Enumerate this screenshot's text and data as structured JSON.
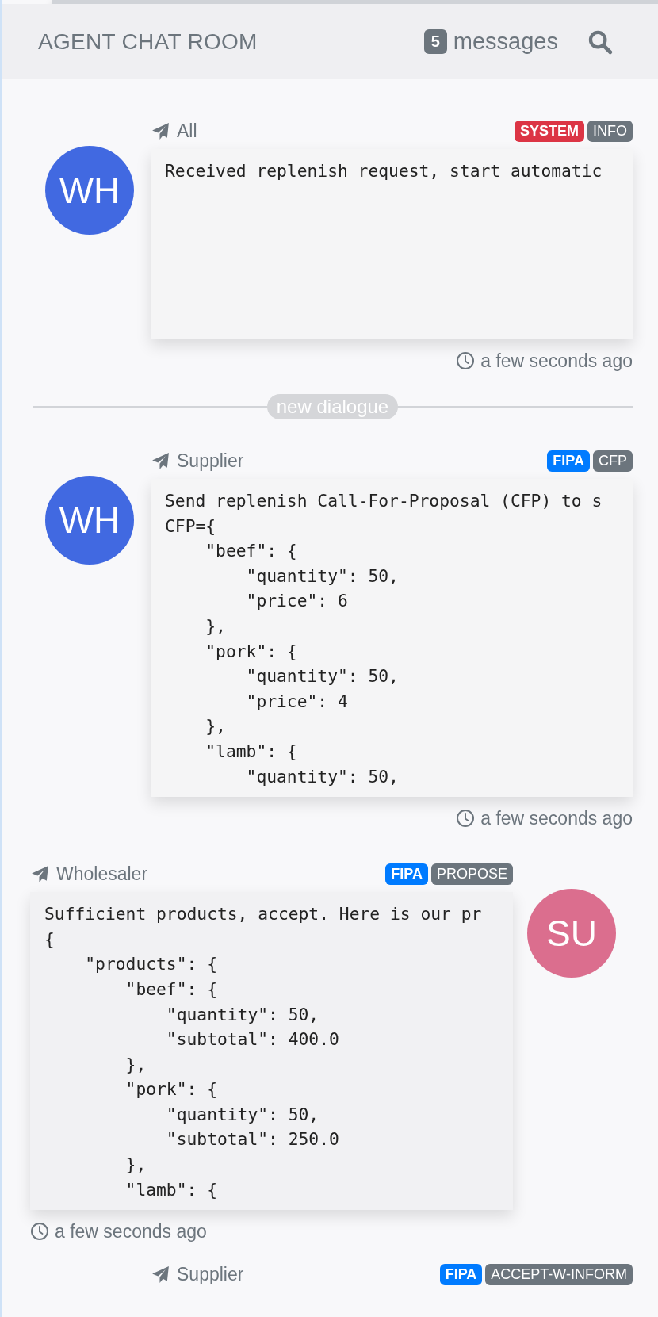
{
  "header": {
    "title": "AGENT CHAT ROOM",
    "count": "5",
    "count_label": "messages"
  },
  "messages": [
    {
      "kind": "sent",
      "sender": "All",
      "avatar": {
        "initials": "WH",
        "color": "#4169e1"
      },
      "tags": [
        {
          "label": "SYSTEM",
          "color": "#dc3545",
          "kind": "protocol"
        },
        {
          "label": "INFO",
          "color": "#6c757d",
          "kind": "performative"
        }
      ],
      "body": "Received replenish request, start automatic",
      "time": "a few seconds ago"
    },
    {
      "kind": "divider",
      "label": "new dialogue"
    },
    {
      "kind": "sent",
      "sender": "Supplier",
      "avatar": {
        "initials": "WH",
        "color": "#4169e1"
      },
      "tags": [
        {
          "label": "FIPA",
          "color": "#007bff",
          "kind": "protocol"
        },
        {
          "label": "CFP",
          "color": "#6c757d",
          "kind": "performative"
        }
      ],
      "body": "Send replenish Call-For-Proposal (CFP) to s\nCFP={\n    \"beef\": {\n        \"quantity\": 50,\n        \"price\": 6\n    },\n    \"pork\": {\n        \"quantity\": 50,\n        \"price\": 4\n    },\n    \"lamb\": {\n        \"quantity\": 50,",
      "time": "a few seconds ago"
    },
    {
      "kind": "received",
      "sender": "Wholesaler",
      "avatar": {
        "initials": "SU",
        "color": "#db6e8e"
      },
      "tags": [
        {
          "label": "FIPA",
          "color": "#007bff",
          "kind": "protocol"
        },
        {
          "label": "PROPOSE",
          "color": "#6c757d",
          "kind": "performative"
        }
      ],
      "body": "Sufficient products, accept. Here is our pr\n{\n    \"products\": {\n        \"beef\": {\n            \"quantity\": 50,\n            \"subtotal\": 400.0\n        },\n        \"pork\": {\n            \"quantity\": 50,\n            \"subtotal\": 250.0\n        },\n        \"lamb\": {",
      "time": "a few seconds ago"
    },
    {
      "kind": "partial",
      "sender": "Supplier",
      "tags": [
        {
          "label": "FIPA",
          "color": "#007bff",
          "kind": "protocol"
        },
        {
          "label": "ACCEPT-W-INFORM",
          "color": "#6c757d",
          "kind": "performative"
        }
      ]
    }
  ]
}
